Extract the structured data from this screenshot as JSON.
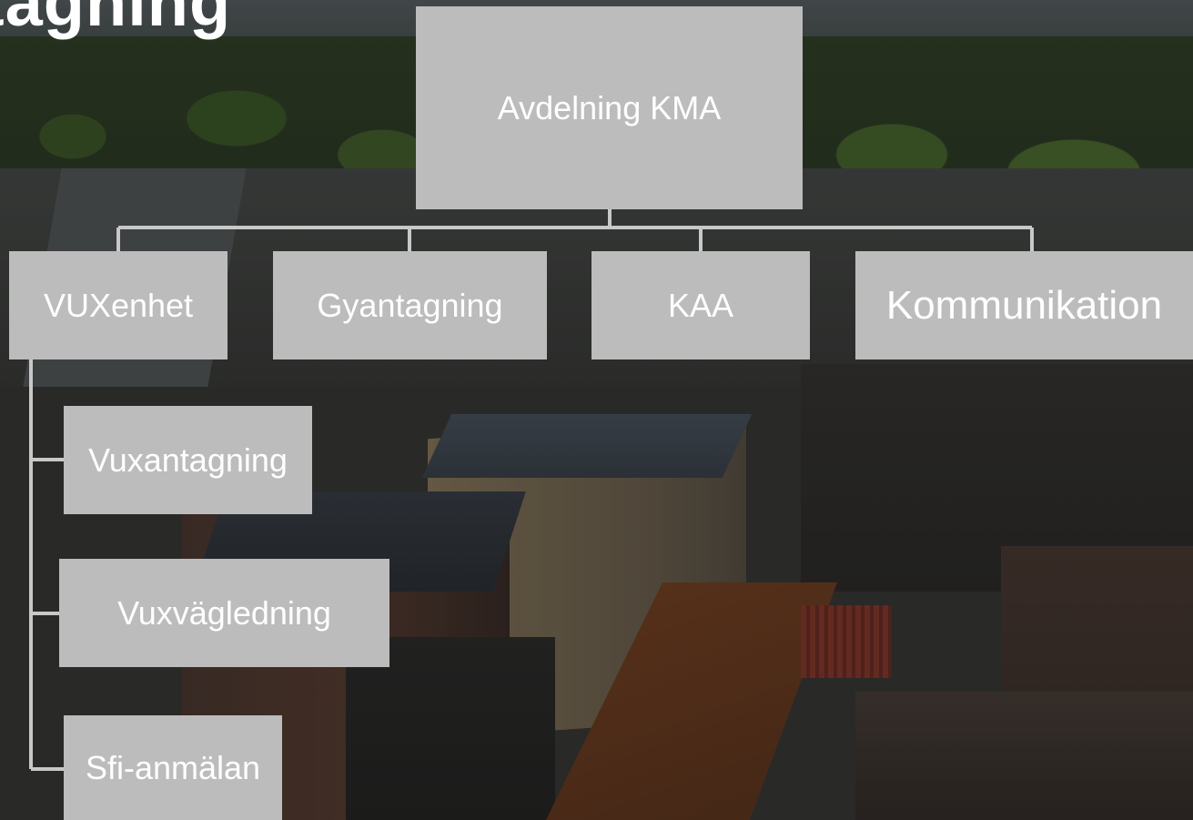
{
  "heading": "tagning",
  "org_chart": {
    "root": {
      "label": "Avdelning KMA"
    },
    "units": [
      {
        "label": "VUXenhet"
      },
      {
        "label": "Gyantagning"
      },
      {
        "label": "KAA"
      },
      {
        "label": "Kommunikation"
      }
    ],
    "vux_subunits": [
      {
        "label": "Vuxantagning"
      },
      {
        "label": "Vuxvägledning"
      },
      {
        "label": "Sfi-anmälan"
      }
    ]
  },
  "colors": {
    "box_fill": "#bcbcbc",
    "box_text": "#ffffff",
    "connector": "#c8c8c8"
  }
}
